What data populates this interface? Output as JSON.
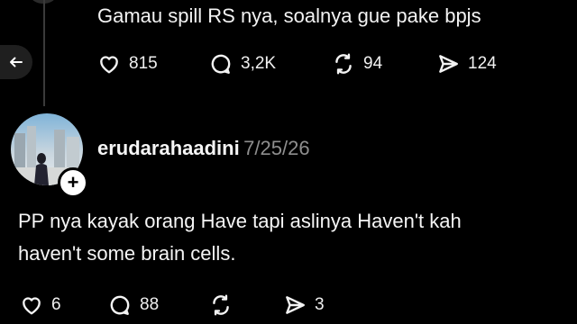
{
  "reply": {
    "text": "Gamau spill RS nya, soalnya gue pake bpjs",
    "likes": "815",
    "comments": "3,2K",
    "reposts": "94",
    "shares": "124"
  },
  "post": {
    "username": "erudarahaadini",
    "date": "7/25/26",
    "line1": "PP nya kayak orang Have tapi aslinya Haven't kah",
    "line2": "haven't some brain cells.",
    "likes": "6",
    "comments": "88",
    "shares": "3"
  },
  "icons": {
    "back": "arrow-left-icon",
    "like": "heart-icon",
    "comment": "comment-bubble-icon",
    "repost": "repost-icon",
    "share": "send-icon",
    "follow": "plus-icon"
  },
  "colors": {
    "background": "#000000",
    "text": "#f3f3f3",
    "muted": "#8e8e8e"
  }
}
